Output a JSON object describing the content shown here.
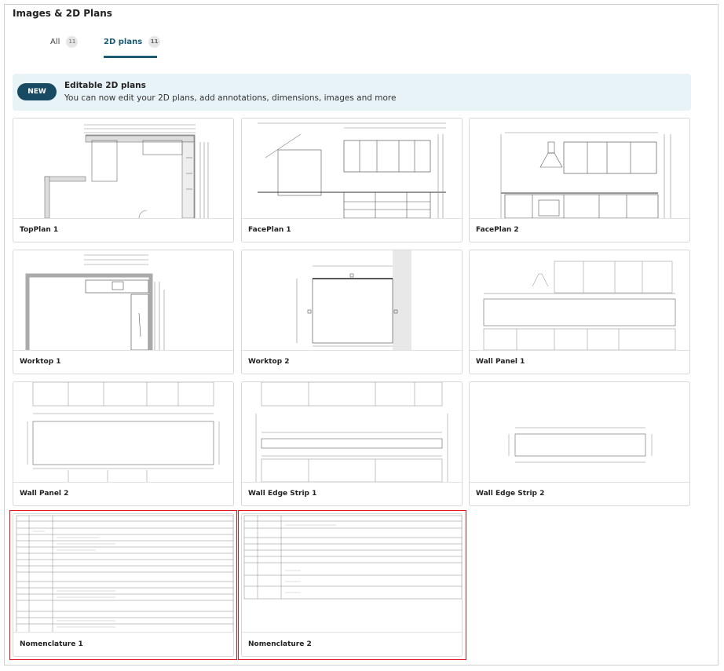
{
  "section": {
    "title": "Images & 2D Plans"
  },
  "tabs": [
    {
      "label": "All",
      "count": "11"
    },
    {
      "label": "2D plans",
      "count": "11"
    }
  ],
  "banner": {
    "badge": "NEW",
    "title": "Editable 2D plans",
    "subtitle": "You can now edit your 2D plans, add annotations, dimensions, images and more"
  },
  "plans": [
    {
      "name": "TopPlan 1"
    },
    {
      "name": "FacePlan 1"
    },
    {
      "name": "FacePlan 2"
    },
    {
      "name": "Worktop 1"
    },
    {
      "name": "Worktop 2"
    },
    {
      "name": "Wall Panel 1"
    },
    {
      "name": "Wall Panel 2"
    },
    {
      "name": "Wall Edge Strip 1"
    },
    {
      "name": "Wall Edge Strip 2"
    },
    {
      "name": "Nomenclature 1"
    },
    {
      "name": "Nomenclature 2"
    }
  ],
  "colors": {
    "accent": "#1c5b74",
    "badge": "#184b63",
    "banner_bg": "#e8f3f8",
    "selection": "#e0181b"
  }
}
